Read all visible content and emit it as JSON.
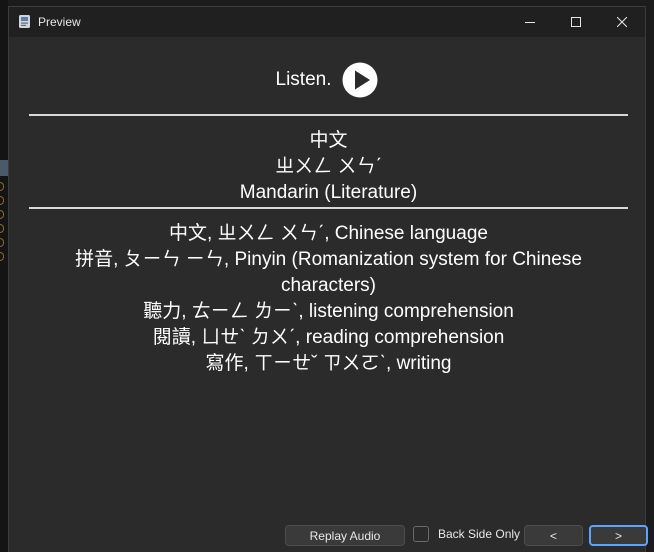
{
  "window": {
    "title": "Preview",
    "minimize_icon": "minimize-icon",
    "maximize_icon": "maximize-icon",
    "close_icon": "close-icon"
  },
  "card": {
    "listen_label": "Listen.",
    "play_icon": "play-circle-icon",
    "front": {
      "hanzi": "中文",
      "zhuyin": "ㄓㄨㄥ ㄨㄣˊ",
      "english": "Mandarin (Literature)"
    },
    "back": [
      "中文, ㄓㄨㄥ ㄨㄣˊ, Chinese language",
      "拼音, ㄆㄧㄣ ㄧㄣ, Pinyin (Romanization system for Chinese characters)",
      "聽力, ㄊㄧㄥ ㄌㄧˋ, listening comprehension",
      "閱讀, ㄩㄝˋ ㄉㄨˊ, reading comprehension",
      "寫作, ㄒㄧㄝˇ ㄗㄨㄛˋ, writing"
    ]
  },
  "footer": {
    "replay_label": "Replay Audio",
    "back_side_only_label": "Back Side Only",
    "back_side_only_checked": false,
    "prev_label": "<",
    "next_label": ">"
  },
  "colors": {
    "background": "#2b2b2b",
    "titlebar": "#202020",
    "focus_accent": "#5ba3ff",
    "text": "#ffffff"
  }
}
